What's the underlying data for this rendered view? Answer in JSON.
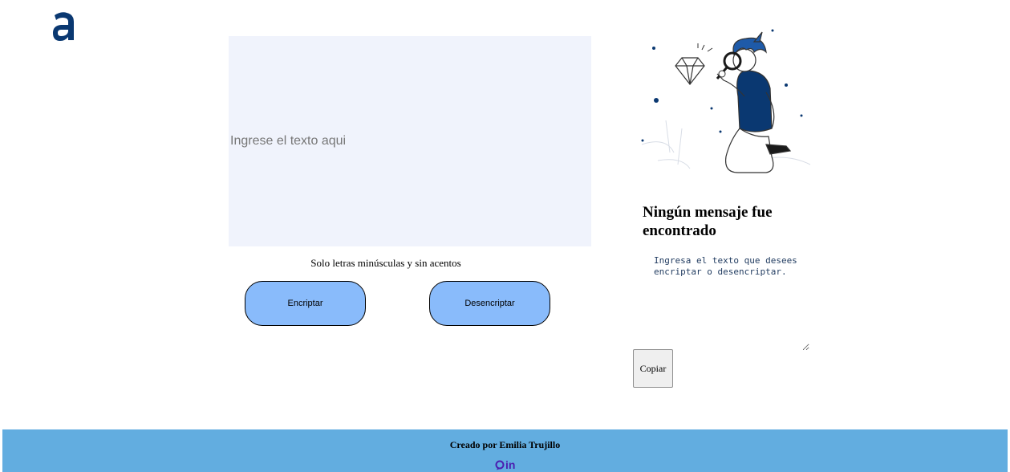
{
  "brand": {
    "logo_icon": "alura-a-logo-icon",
    "color": "#0a3871"
  },
  "encoder": {
    "input_placeholder": "Ingrese el texto aqui",
    "hint": "Solo letras minúsculas y sin acentos",
    "encrypt_label": "Encriptar",
    "decrypt_label": "Desencriptar",
    "button_color": "#89bbfb"
  },
  "result": {
    "illustration_icon": "boy-with-magnifying-glass-illustration",
    "title": "Ningún mensaje fue encontrado",
    "text": "Ingresa el texto que desees encriptar o desencriptar.",
    "copy_label": "Copiar"
  },
  "footer": {
    "credit": "Creado por Emilia Trujillo",
    "github_icon": "github-icon",
    "linkedin_label": "in",
    "background": "#62ade0"
  }
}
